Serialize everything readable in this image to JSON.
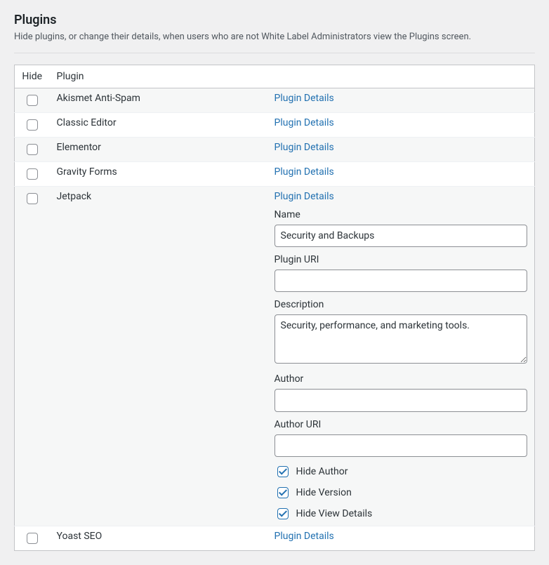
{
  "section": {
    "title": "Plugins",
    "description": "Hide plugins, or change their details, when users who are not White Label Administrators view the Plugins screen."
  },
  "table": {
    "headers": {
      "hide": "Hide",
      "plugin": "Plugin"
    },
    "detail_link_label": "Plugin Details"
  },
  "plugins": [
    {
      "name": "Akismet Anti-Spam",
      "striped": true,
      "expanded": false
    },
    {
      "name": "Classic Editor",
      "striped": false,
      "expanded": false
    },
    {
      "name": "Elementor",
      "striped": true,
      "expanded": false
    },
    {
      "name": "Gravity Forms",
      "striped": false,
      "expanded": false
    },
    {
      "name": "Jetpack",
      "striped": true,
      "expanded": true,
      "details": {
        "name_label": "Name",
        "name_value": "Security and Backups",
        "uri_label": "Plugin URI",
        "uri_value": "",
        "desc_label": "Description",
        "desc_value": "Security, performance, and marketing tools.",
        "author_label": "Author",
        "author_value": "",
        "author_uri_label": "Author URI",
        "author_uri_value": "",
        "hide_author_label": "Hide Author",
        "hide_author_checked": true,
        "hide_version_label": "Hide Version",
        "hide_version_checked": true,
        "hide_view_details_label": "Hide View Details",
        "hide_view_details_checked": true
      }
    },
    {
      "name": "Yoast SEO",
      "striped": false,
      "expanded": false
    }
  ]
}
